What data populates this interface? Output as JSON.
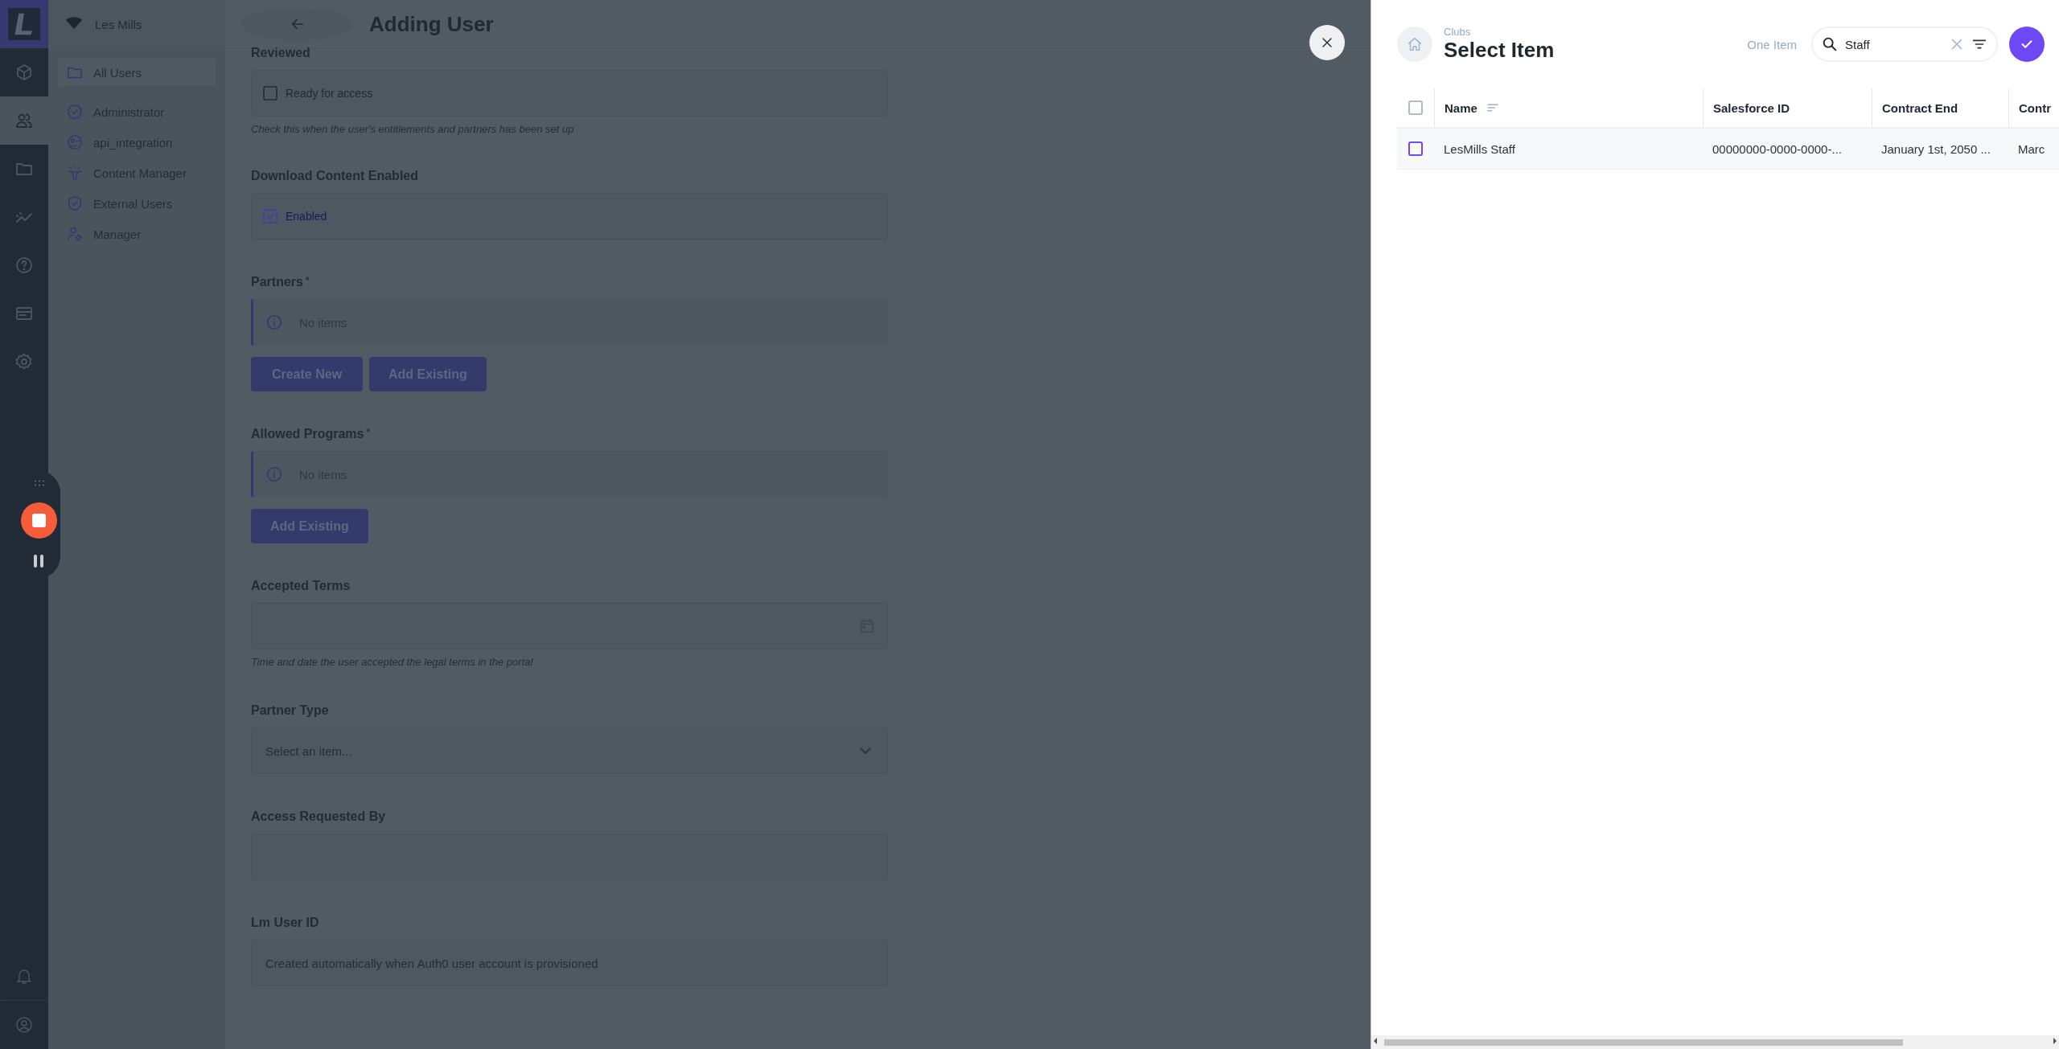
{
  "rail": {
    "items": [
      {
        "kind": "cube",
        "selected": false
      },
      {
        "kind": "users",
        "selected": true
      },
      {
        "kind": "folder",
        "selected": false
      },
      {
        "kind": "chart",
        "selected": false
      },
      {
        "kind": "help",
        "selected": false
      },
      {
        "kind": "card",
        "selected": false
      },
      {
        "kind": "settings",
        "selected": false
      }
    ],
    "bottom": [
      {
        "kind": "bell"
      },
      {
        "kind": "profile"
      }
    ]
  },
  "sidebar": {
    "org": "Les Mills",
    "items": [
      {
        "label": "All Users",
        "kind": "folder",
        "selected": true
      },
      {
        "label": "Administrator",
        "kind": "badge",
        "selected": false
      },
      {
        "label": "api_integration",
        "kind": "bot",
        "selected": false
      },
      {
        "label": "Content Manager",
        "kind": "spark",
        "selected": false
      },
      {
        "label": "External Users",
        "kind": "shield",
        "selected": false
      },
      {
        "label": "Manager",
        "kind": "usergear",
        "selected": false
      }
    ]
  },
  "form": {
    "title": "Adding User",
    "fields": [
      {
        "kind": "checkbox",
        "label": "Reviewed",
        "option": "Ready for access",
        "checked": false,
        "help": "Check this when the user's entitlements and partners has been set up"
      },
      {
        "kind": "checkbox",
        "label": "Download Content Enabled",
        "option": "Enabled",
        "checked": true
      },
      {
        "kind": "relation",
        "label": "Partners",
        "required": true,
        "marker": "*",
        "message": "No items",
        "buttons": [
          "Create New",
          "Add Existing"
        ]
      },
      {
        "kind": "relation",
        "label": "Allowed Programs",
        "required": true,
        "marker": "*",
        "message": "No items",
        "buttons": [
          "Add Existing"
        ]
      },
      {
        "kind": "date",
        "label": "Accepted Terms",
        "help": "Time and date the user accepted the legal terms in the portal"
      },
      {
        "kind": "select",
        "label": "Partner Type",
        "placeholder": "Select an item..."
      },
      {
        "kind": "text",
        "label": "Access Requested By"
      },
      {
        "kind": "text",
        "label": "Lm User ID",
        "placeholder": "Created automatically when Auth0 user account is provisioned"
      }
    ]
  },
  "panel": {
    "breadcrumb": "Clubs",
    "title": "Select Item",
    "count": "One Item",
    "search": {
      "value": "Staff"
    },
    "table": {
      "all_checked": false,
      "columns": [
        {
          "label": "Name",
          "sortable": true
        },
        {
          "label": "Salesforce ID"
        },
        {
          "label": "Contract End"
        },
        {
          "label": "Contr"
        }
      ],
      "rows": [
        {
          "selected": false,
          "cells": [
            "LesMills Staff",
            "00000000-0000-0000-...",
            "January 1st, 2050 ...",
            "Marc"
          ]
        }
      ]
    }
  }
}
